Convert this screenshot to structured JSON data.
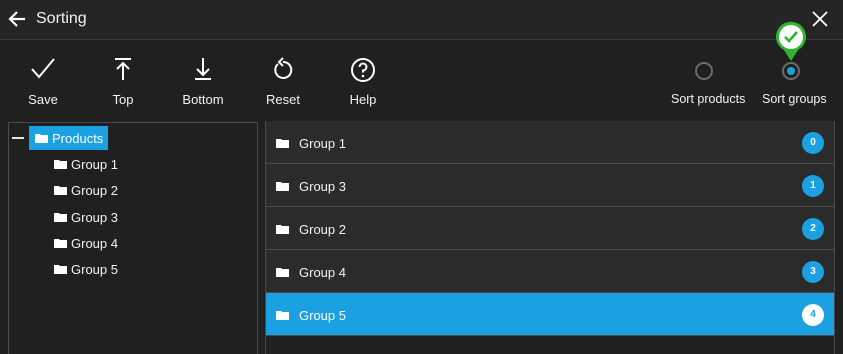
{
  "window": {
    "title": "Sorting"
  },
  "toolbar": {
    "save_label": "Save",
    "top_label": "Top",
    "bottom_label": "Bottom",
    "reset_label": "Reset",
    "help_label": "Help"
  },
  "sort_mode": {
    "products_label": "Sort products",
    "groups_label": "Sort groups",
    "selected": "Sort groups"
  },
  "tree": {
    "root_label": "Products",
    "children": [
      "Group 1",
      "Group 2",
      "Group 3",
      "Group 4",
      "Group 5"
    ]
  },
  "list": {
    "items": [
      {
        "label": "Group 1",
        "order": "0"
      },
      {
        "label": "Group 3",
        "order": "1"
      },
      {
        "label": "Group 2",
        "order": "2"
      },
      {
        "label": "Group 4",
        "order": "3"
      },
      {
        "label": "Group 5",
        "order": "4"
      }
    ],
    "selected_index": 4
  },
  "colors": {
    "accent": "#1ba1e2",
    "background": "#202020",
    "row": "#2b2b2b",
    "confirm": "#2db52d"
  },
  "icons": [
    "back-arrow-icon",
    "close-icon",
    "checkmark-icon",
    "arrow-to-top-icon",
    "arrow-to-bottom-icon",
    "reset-icon",
    "help-icon",
    "folder-icon",
    "collapse-icon",
    "check-badge-icon"
  ]
}
